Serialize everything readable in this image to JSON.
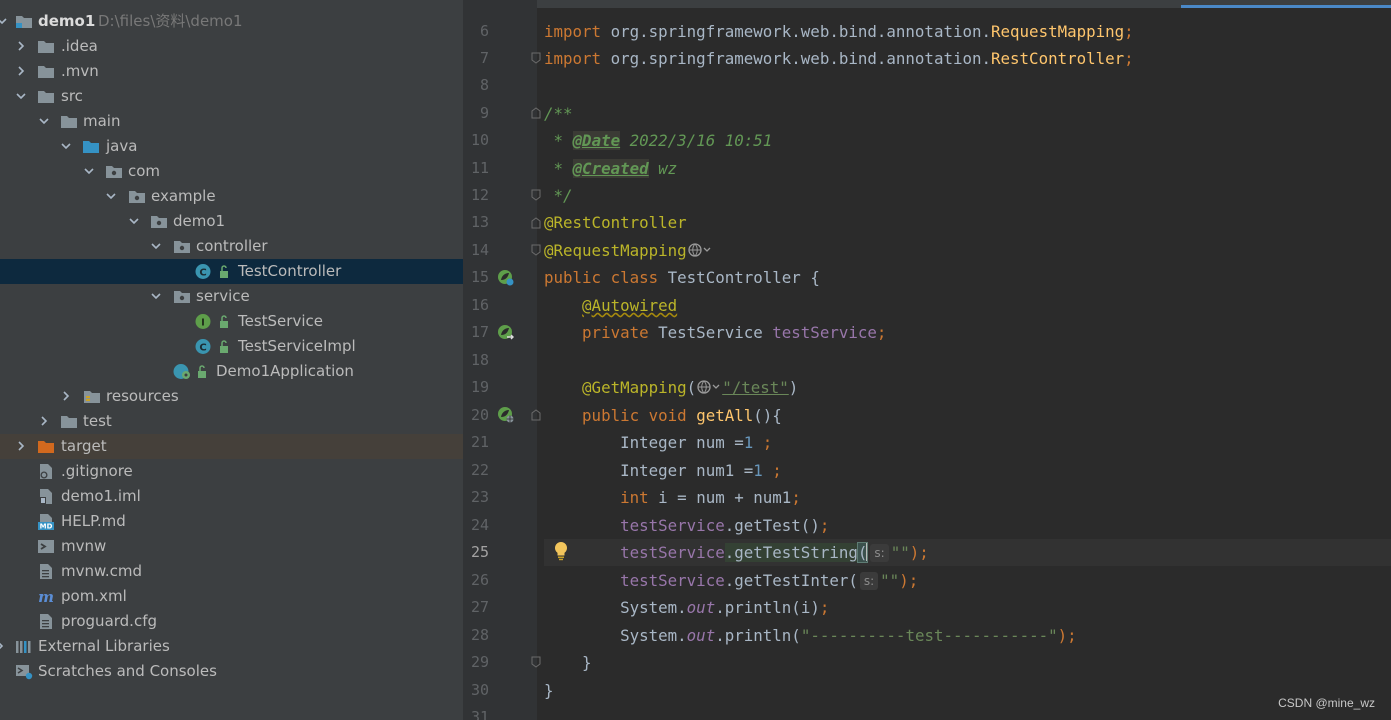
{
  "project_tree": {
    "root_name": "demo1",
    "root_path": "D:\\files\\资料\\demo1",
    "items": [
      {
        "label": "demo1",
        "icon": "module-folder-icon"
      },
      {
        "label": ".idea",
        "icon": "folder-icon"
      },
      {
        "label": ".mvn",
        "icon": "folder-icon"
      },
      {
        "label": "src",
        "icon": "folder-icon"
      },
      {
        "label": "main",
        "icon": "folder-icon"
      },
      {
        "label": "java",
        "icon": "source-folder-icon"
      },
      {
        "label": "com",
        "icon": "package-icon"
      },
      {
        "label": "example",
        "icon": "package-icon"
      },
      {
        "label": "demo1",
        "icon": "package-icon"
      },
      {
        "label": "controller",
        "icon": "package-icon"
      },
      {
        "label": "TestController",
        "icon": "class-icon"
      },
      {
        "label": "service",
        "icon": "package-icon"
      },
      {
        "label": "TestService",
        "icon": "interface-icon"
      },
      {
        "label": "TestServiceImpl",
        "icon": "class-icon"
      },
      {
        "label": "Demo1Application",
        "icon": "spring-boot-app-icon"
      },
      {
        "label": "resources",
        "icon": "resources-folder-icon"
      },
      {
        "label": "test",
        "icon": "folder-icon"
      },
      {
        "label": "target",
        "icon": "excluded-folder-icon"
      },
      {
        "label": ".gitignore",
        "icon": "gitignore-file-icon"
      },
      {
        "label": "demo1.iml",
        "icon": "iml-file-icon"
      },
      {
        "label": "HELP.md",
        "icon": "markdown-file-icon"
      },
      {
        "label": "mvnw",
        "icon": "shell-file-icon"
      },
      {
        "label": "mvnw.cmd",
        "icon": "text-file-icon"
      },
      {
        "label": "pom.xml",
        "icon": "maven-file-icon"
      },
      {
        "label": "proguard.cfg",
        "icon": "text-file-icon"
      },
      {
        "label": "External Libraries",
        "icon": "libraries-icon"
      },
      {
        "label": "Scratches and Consoles",
        "icon": "scratches-icon"
      }
    ]
  },
  "editor": {
    "current_line": "25",
    "lines": [
      {
        "num": "6",
        "kw": "import",
        "rest": " org.springframework.web.bind.annotation.",
        "cls": "RequestMapping",
        "end": ";"
      },
      {
        "num": "7",
        "kw": "import",
        "rest": " org.springframework.web.bind.annotation.",
        "cls": "RestController",
        "end": ";"
      },
      {
        "num": "8"
      },
      {
        "num": "9",
        "doc": "/**"
      },
      {
        "num": "10",
        "doc_prefix": " * ",
        "doc_tag": "@Date",
        "doc_text": " 2022/3/16 10:51"
      },
      {
        "num": "11",
        "doc_prefix": " * ",
        "doc_tag": "@Created",
        "doc_text": " wz"
      },
      {
        "num": "12",
        "doc": " */"
      },
      {
        "num": "13",
        "ann": "@RestController"
      },
      {
        "num": "14",
        "ann": "@RequestMapping"
      },
      {
        "num": "15",
        "kw": "public class",
        "name": " TestController ",
        "end": "{"
      },
      {
        "num": "16",
        "ann": "@Autowired"
      },
      {
        "num": "17",
        "kw": "private",
        "type": " TestService ",
        "field": "testService",
        "end": ";"
      },
      {
        "num": "18"
      },
      {
        "num": "19",
        "ann": "@GetMapping",
        "paren_open": "(",
        "str": "\"/test\"",
        "paren_close": ")"
      },
      {
        "num": "20",
        "kw": "public void",
        "method": "getAll",
        "end": "(){"
      },
      {
        "num": "21",
        "type": "Integer num =",
        "num_val": "1",
        "end": " ;"
      },
      {
        "num": "22",
        "type": "Integer num1 =",
        "num_val": "1",
        "end": " ;"
      },
      {
        "num": "23",
        "kw": "int",
        "rest": " i = num + num1",
        "end": ";"
      },
      {
        "num": "24",
        "field": "testService",
        "call": ".getTest()",
        "end": ";"
      },
      {
        "num": "25",
        "field": "testService",
        "call": ".getTestString",
        "hint": "s:",
        "str": "\"\"",
        "end": ");"
      },
      {
        "num": "26",
        "field": "testService",
        "call": ".getTestInter(",
        "hint": "s:",
        "str": "\"\"",
        "end": ");"
      },
      {
        "num": "27",
        "sys": "System.",
        "static_field": "out",
        "call": ".println(i)",
        "end": ";"
      },
      {
        "num": "28",
        "sys": "System.",
        "static_field": "out",
        "call": ".println(",
        "str": "\"----------test-----------\"",
        "end": ");"
      },
      {
        "num": "29",
        "brace": "}"
      },
      {
        "num": "30",
        "brace": "}"
      },
      {
        "num": "31"
      }
    ]
  },
  "watermark": "CSDN @mine_wz",
  "colors": {
    "keyword": "#cc7832",
    "annotation": "#bbb529",
    "string": "#6a8759",
    "number": "#6897bb",
    "field": "#9876aa",
    "doc": "#629755",
    "selection": "#0d293e"
  }
}
